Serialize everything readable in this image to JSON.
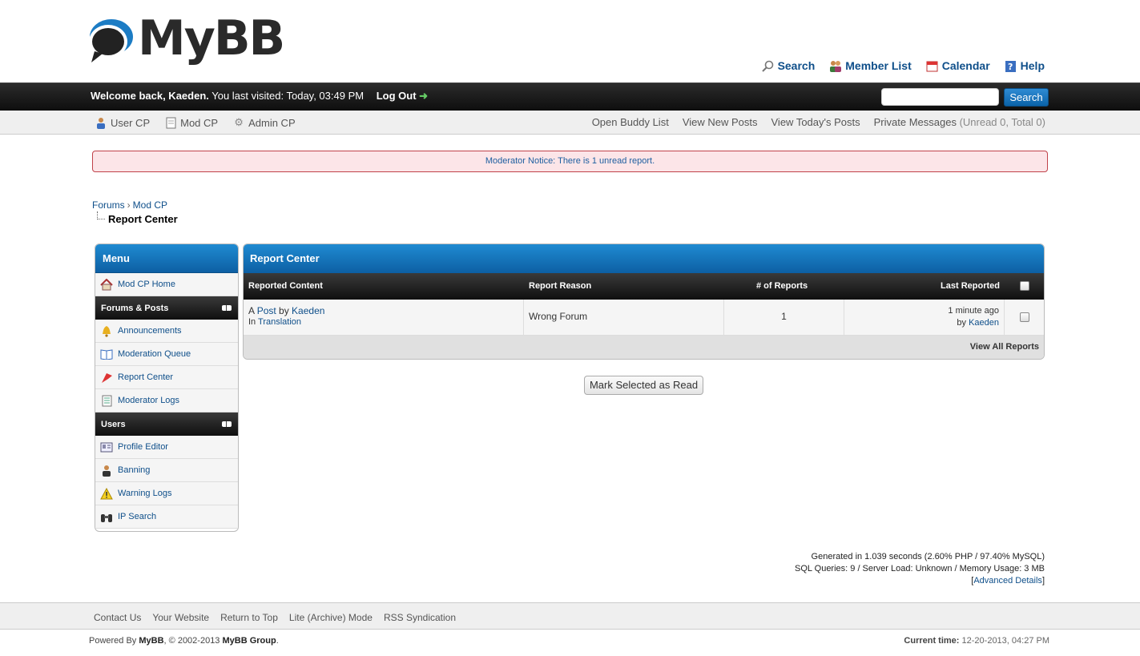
{
  "header": {
    "logo_text": "MyBB",
    "top_links": [
      {
        "label": "Search",
        "icon": "magnifier-icon"
      },
      {
        "label": "Member List",
        "icon": "members-icon"
      },
      {
        "label": "Calendar",
        "icon": "calendar-icon"
      },
      {
        "label": "Help",
        "icon": "help-icon"
      }
    ]
  },
  "welcome": {
    "greeting": "Welcome back, Kaeden.",
    "last_visit": " You last visited: Today, 03:49 PM",
    "logout_label": "Log Out",
    "search_button": "Search",
    "search_value": ""
  },
  "panel": {
    "left": [
      {
        "label": "User CP",
        "icon": "user-icon"
      },
      {
        "label": "Mod CP",
        "icon": "page-icon"
      },
      {
        "label": "Admin CP",
        "icon": "gear-icon"
      }
    ],
    "right": {
      "buddy": "Open Buddy List",
      "new_posts": "View New Posts",
      "today": "View Today's Posts",
      "pm_label": "Private Messages",
      "pm_counts": " (Unread 0, Total 0)"
    }
  },
  "notice": "Moderator Notice: There is 1 unread report.",
  "breadcrumb": {
    "items": [
      "Forums",
      "Mod CP"
    ],
    "separator": "›",
    "current": "Report Center"
  },
  "menu": {
    "title": "Menu",
    "home": "Mod CP Home",
    "sections": [
      {
        "title": "Forums & Posts",
        "items": [
          "Announcements",
          "Moderation Queue",
          "Report Center",
          "Moderator Logs"
        ]
      },
      {
        "title": "Users",
        "items": [
          "Profile Editor",
          "Banning",
          "Warning Logs",
          "IP Search"
        ]
      }
    ]
  },
  "report_center": {
    "title": "Report Center",
    "columns": [
      "Reported Content",
      "Report Reason",
      "# of Reports",
      "Last Reported"
    ],
    "rows": [
      {
        "prefix": "A ",
        "content_link": "Post",
        "by": " by ",
        "author": "Kaeden",
        "in_label": "In ",
        "forum": "Translation",
        "reason": "Wrong Forum",
        "count": "1",
        "last_time": "1 minute ago",
        "last_by_label": "by ",
        "last_by": "Kaeden"
      }
    ],
    "view_all": "View All Reports",
    "mark_button": "Mark Selected as Read"
  },
  "debug": {
    "line1": "Generated in 1.039 seconds (2.60% PHP / 97.40% MySQL)",
    "line2": "SQL Queries: 9 / Server Load: Unknown / Memory Usage: 3 MB",
    "advanced": "Advanced Details"
  },
  "footer": {
    "links": [
      "Contact Us",
      "Your Website",
      "Return to Top",
      "Lite (Archive) Mode",
      "RSS Syndication"
    ],
    "powered_prefix": "Powered By ",
    "powered_mybb": "MyBB",
    "powered_mid": ", © 2002-2013 ",
    "powered_group": "MyBB Group",
    "powered_end": ".",
    "time_label": "Current time:",
    "time_value": " 12-20-2013, 04:27 PM"
  },
  "colors": {
    "accent_blue": "#0d5fa3",
    "link": "#0f4f8a",
    "notice_bg": "#fce5e8",
    "notice_border": "#c0424a",
    "dark_bar": "#0e0e0e"
  }
}
